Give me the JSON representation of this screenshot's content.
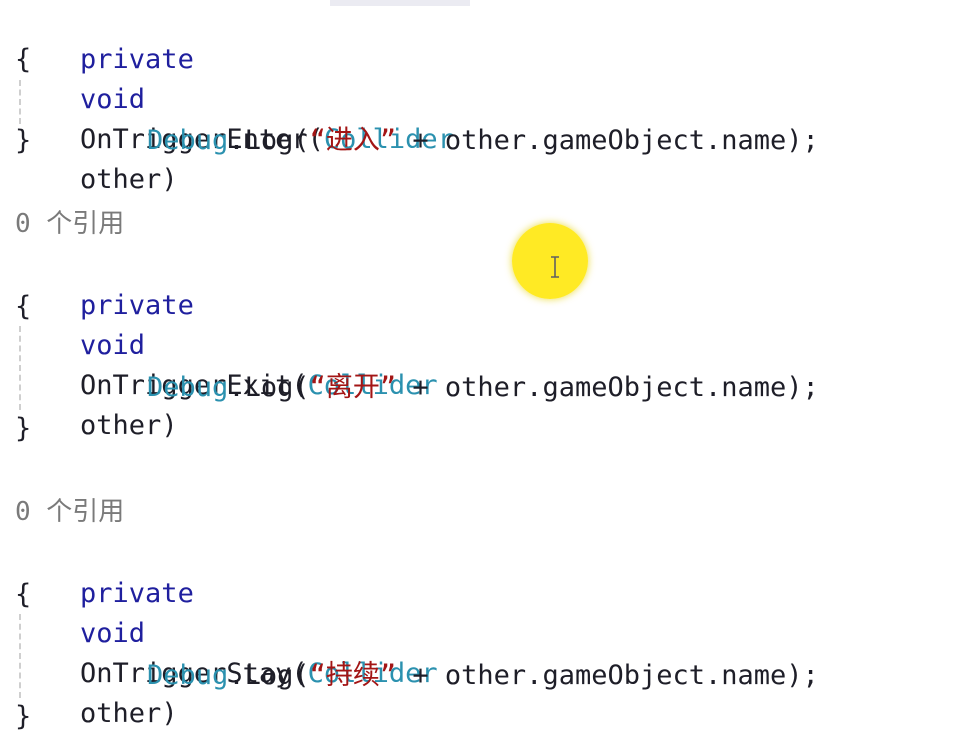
{
  "code": {
    "method_enter": {
      "modifier": "private",
      "return_type": "void",
      "name": "OnTriggerEnter",
      "open_paren": "(",
      "param_type": "Collider",
      "param_name": "other",
      "close_paren": ")",
      "open_brace": "{",
      "body_class": "Debug",
      "body_dot": ".",
      "body_method": "Log",
      "body_open": "(",
      "body_string": "“进入”",
      "body_rest": " + other.gameObject.name);",
      "close_brace": "}"
    },
    "method_exit": {
      "reference_count": "0 个引用",
      "modifier": "private",
      "return_type": "void",
      "name": "OnTriggerExit",
      "open_paren": "(",
      "param_type": "Collider",
      "param_name": "other",
      "close_paren": ")",
      "open_brace": "{",
      "body_class": "Debug",
      "body_dot": ".",
      "body_method": "Log",
      "body_open": "(",
      "body_string": "“离开”",
      "body_rest": " + other.gameObject.name);",
      "close_brace": "}"
    },
    "method_stay": {
      "reference_count": "0 个引用",
      "modifier": "private",
      "return_type": "void",
      "name": "OnTriggerStay",
      "open_paren": "(",
      "param_type": "Collider",
      "param_name": "other",
      "close_paren": ")",
      "open_brace": "{",
      "body_class": "Debug",
      "body_dot": ".",
      "body_method": "Log",
      "body_open": "(",
      "body_string": "“持续”",
      "body_rest": " + other.gameObject.name);",
      "close_brace": "}"
    }
  },
  "colors": {
    "keyword": "#1f1f9e",
    "identifier": "#1e1e28",
    "type": "#2b91af",
    "string": "#a31515",
    "codelens": "#7a7a7a",
    "cursor_highlight": "#ffe600"
  },
  "icons": {
    "cursor": "i-beam-cursor-icon"
  }
}
